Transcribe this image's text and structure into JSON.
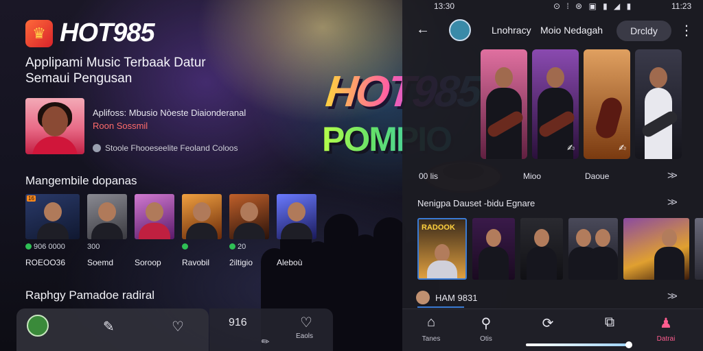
{
  "brand": {
    "name": "HOT985"
  },
  "tagline": "Applipami Music Terbaak Datur Semaui Pengusan",
  "featured": {
    "title": "Aplifoss: Mbusio Nòeste Diaionderanal",
    "subtitle": "Roon Sossmil",
    "meta": "Stoole Fhooeseelite Feoland Coloos"
  },
  "section1": {
    "title": "Mangembile dopanas"
  },
  "cards": [
    {
      "badge": "16",
      "count": "906 0000",
      "label": "ROEOO36",
      "art": "#2a3a6a"
    },
    {
      "badge": "",
      "count": "300",
      "label": "Soemd",
      "art": "#6a6a70"
    },
    {
      "badge": "",
      "count": "",
      "label": "Soroop",
      "art": "#9a3a8a"
    },
    {
      "badge": "",
      "count": "",
      "label": "Ravobil",
      "art": "#b8681a"
    },
    {
      "badge": "",
      "count": "20",
      "label": "2iltigio",
      "art": "#4a2a1a"
    },
    {
      "badge": "",
      "count": "",
      "label": "Aleboù",
      "art": "#3a4aaa"
    }
  ],
  "section2": {
    "title": "Raphgy Pamadoe radiral"
  },
  "left_bottom": {
    "number": "916",
    "label": "Eaols",
    "icons": [
      "avatar",
      "chat-icon",
      "heart-icon"
    ]
  },
  "logo": {
    "line1": "HOT985",
    "line2": "POMPIO"
  },
  "status_bar": {
    "time": "13:30",
    "icons": "⊙ ⁞ ⊛ ▣ ▮ ◢ ▮",
    "right": "11:23"
  },
  "app_bar": {
    "name1": "Lnohracy",
    "name2": "Moio Nedagah",
    "pill": "Drcldy"
  },
  "artist_meta": {
    "left": "00 lis",
    "middle": "Mioo",
    "right": "Daoue"
  },
  "artists": [
    {
      "bg": "#c0507a"
    },
    {
      "bg": "#5a2a7a"
    },
    {
      "bg": "#b8661e"
    },
    {
      "bg": "#2a2a3a"
    }
  ],
  "now_playing": {
    "title": "Nenigpa Dauset -bidu Egnare"
  },
  "albums": [
    {
      "text": "RADOOK",
      "bg": "#3a2a1a",
      "width": 72
    },
    {
      "text": "",
      "bg": "#2a1a3a",
      "width": 62
    },
    {
      "text": "",
      "bg": "#1a1a1e",
      "width": 62
    },
    {
      "text": "",
      "bg": "#2a2a3a",
      "width": 72
    },
    {
      "text": "",
      "bg": "#4a2a1a",
      "width": 96
    },
    {
      "text": "",
      "bg": "#3a3a4a",
      "width": 20
    }
  ],
  "mini_player": {
    "text": "HAM 9831"
  },
  "bottom_nav": [
    {
      "label": "Tanes",
      "icon": "⌂"
    },
    {
      "label": "Otis",
      "icon": "⚲"
    },
    {
      "label": "",
      "icon": "⟳"
    },
    {
      "label": "",
      "icon": "⧉"
    },
    {
      "label": "Datrai",
      "icon": "♟"
    }
  ],
  "progress": 1.0
}
